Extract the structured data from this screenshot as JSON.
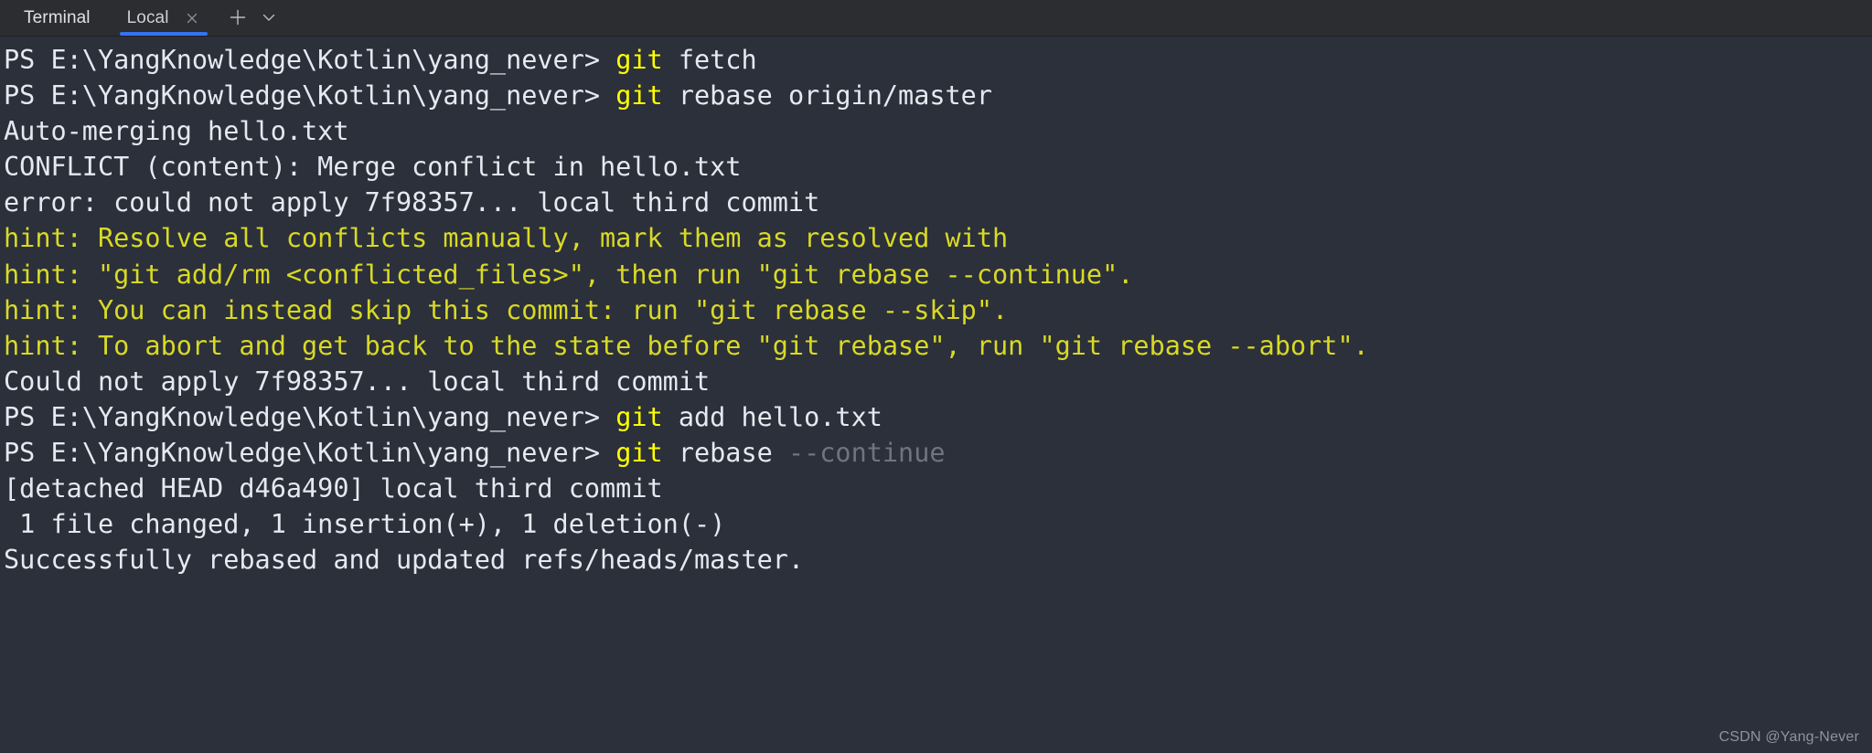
{
  "tabbar": {
    "title": "Terminal",
    "tab_label": "Local",
    "close_icon": "close-icon",
    "add_icon": "plus-icon",
    "dropdown_icon": "chevron-down-icon",
    "accent_color": "#3574f0",
    "background": "#2b2d30"
  },
  "terminal": {
    "background": "#2b303b",
    "prompt": "PS E:\\YangKnowledge\\Kotlin\\yang_never>",
    "colors": {
      "text": "#e6e9ef",
      "command": "#ffff00",
      "hint": "#d9d925",
      "ghost": "#6e7480"
    },
    "lines": [
      {
        "type": "prompt",
        "prompt": "PS E:\\YangKnowledge\\Kotlin\\yang_never>",
        "command": "git",
        "args": " fetch",
        "ghost": ""
      },
      {
        "type": "prompt",
        "prompt": "PS E:\\YangKnowledge\\Kotlin\\yang_never>",
        "command": "git",
        "args": " rebase origin/master",
        "ghost": ""
      },
      {
        "type": "output",
        "text": "Auto-merging hello.txt"
      },
      {
        "type": "output",
        "text": "CONFLICT (content): Merge conflict in hello.txt"
      },
      {
        "type": "output",
        "text": "error: could not apply 7f98357... local third commit"
      },
      {
        "type": "hint",
        "text": "hint: Resolve all conflicts manually, mark them as resolved with"
      },
      {
        "type": "hint",
        "text": "hint: \"git add/rm <conflicted_files>\", then run \"git rebase --continue\"."
      },
      {
        "type": "hint",
        "text": "hint: You can instead skip this commit: run \"git rebase --skip\"."
      },
      {
        "type": "hint",
        "text": "hint: To abort and get back to the state before \"git rebase\", run \"git rebase --abort\"."
      },
      {
        "type": "output",
        "text": "Could not apply 7f98357... local third commit"
      },
      {
        "type": "prompt",
        "prompt": "PS E:\\YangKnowledge\\Kotlin\\yang_never>",
        "command": "git",
        "args": " add hello.txt",
        "ghost": ""
      },
      {
        "type": "prompt",
        "prompt": "PS E:\\YangKnowledge\\Kotlin\\yang_never>",
        "command": "git",
        "args": " rebase ",
        "ghost": "--continue"
      },
      {
        "type": "output",
        "text": "[detached HEAD d46a490] local third commit"
      },
      {
        "type": "output",
        "text": " 1 file changed, 1 insertion(+), 1 deletion(-)"
      },
      {
        "type": "output",
        "text": "Successfully rebased and updated refs/heads/master."
      }
    ]
  },
  "watermark": {
    "text": "CSDN @Yang-Never"
  }
}
